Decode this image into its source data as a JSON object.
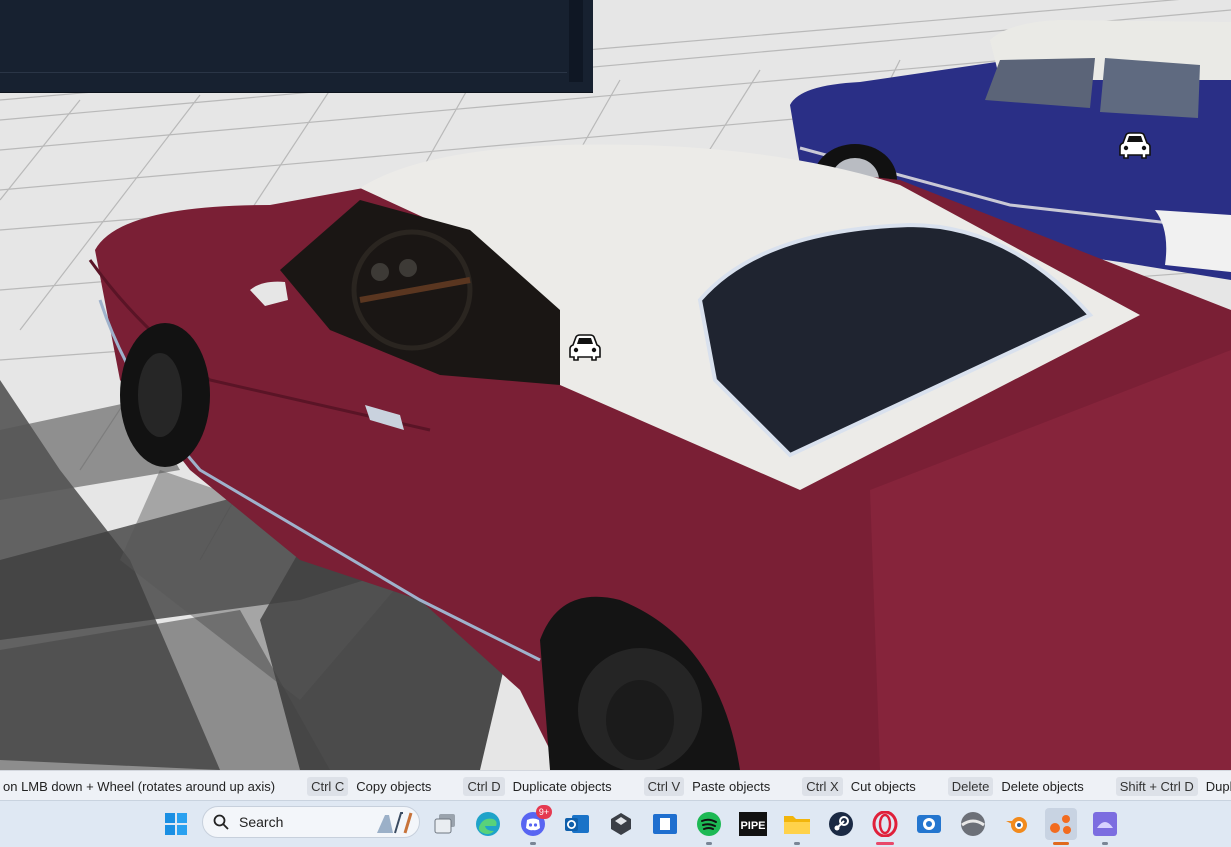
{
  "viewport": {
    "markers": [
      {
        "name": "vehicle-marker-icon"
      },
      {
        "name": "vehicle-marker-icon"
      }
    ]
  },
  "statusbar": {
    "lead": "on LMB down + Wheel (rotates around up axis)",
    "hints": [
      {
        "key": "Ctrl C",
        "action": "Copy objects"
      },
      {
        "key": "Ctrl D",
        "action": "Duplicate objects"
      },
      {
        "key": "Ctrl V",
        "action": "Paste objects"
      },
      {
        "key": "Ctrl X",
        "action": "Cut objects"
      },
      {
        "key": "Delete",
        "action": "Delete objects"
      },
      {
        "key": "Shift + Ctrl D",
        "action": "Duplicate at cursor"
      }
    ]
  },
  "taskbar": {
    "search_label": "Search",
    "discord_badge": "9+",
    "apps": [
      "start-icon",
      "search",
      "task-view-icon",
      "edge-icon",
      "discord-icon",
      "outlook-icon",
      "unity-hub-icon",
      "store-icon",
      "spotify-icon",
      "pipe-icon",
      "file-explorer-icon",
      "steam-icon",
      "opera-icon",
      "camera-app-icon",
      "game-icon",
      "blender-icon",
      "beamng-editor-icon",
      "launcher-icon"
    ]
  },
  "colors": {
    "panel": "#172130",
    "car_body": "#7a1f35",
    "car_roof": "#ecebe8",
    "blue_car": "#2a2f86"
  }
}
